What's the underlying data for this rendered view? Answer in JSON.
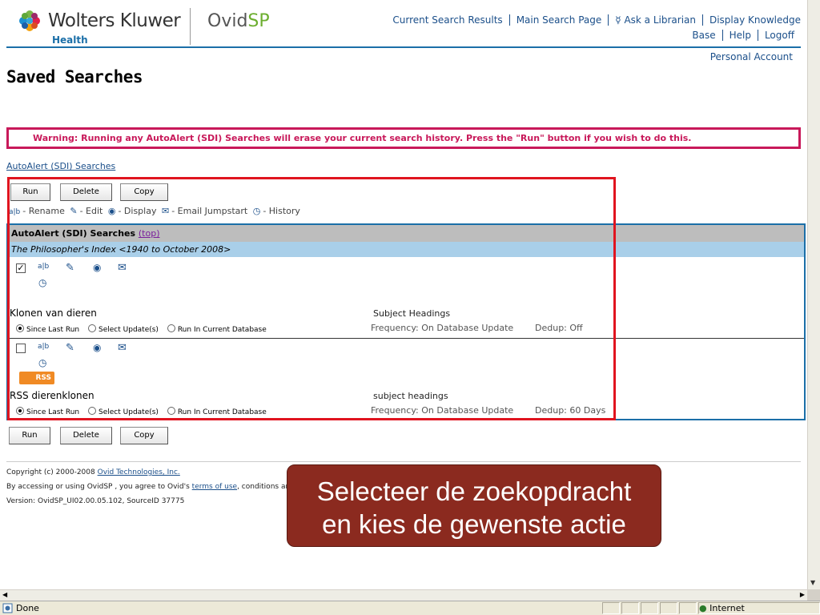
{
  "brand": {
    "company": "Wolters Kluwer",
    "division": "Health",
    "product_a": "Ovid",
    "product_b": "SP"
  },
  "nav": {
    "links": [
      "Current Search Results",
      "Main Search Page",
      "Ask a Librarian",
      "Display Knowledge"
    ],
    "links_row2": [
      "Base",
      "Help",
      "Logoff"
    ],
    "personal": "Personal Account"
  },
  "page_title": "Saved Searches",
  "warning": "Warning: Running any AutoAlert (SDI) Searches will erase your current search history. Press the \"Run\" button if you wish to do this.",
  "section_link": "AutoAlert (SDI) Searches",
  "buttons": {
    "run": "Run",
    "delete": "Delete",
    "copy": "Copy"
  },
  "legend": {
    "rename": "- Rename",
    "edit": "- Edit",
    "display": "- Display",
    "email": "- Email Jumpstart",
    "history": "- History"
  },
  "results": {
    "header": "AutoAlert (SDI) Searches",
    "top_link": "(top)",
    "database": "The Philosopher's Index <1940 to October 2008>",
    "radio_options": [
      "Since Last Run",
      "Select Update(s)",
      "Run In Current Database"
    ],
    "rows": [
      {
        "checked": true,
        "name": "Klonen van dieren",
        "subject": "Subject Headings",
        "frequency": "Frequency: On Database Update",
        "dedup": "Dedup: Off"
      },
      {
        "checked": false,
        "name": "RSS dierenklonen",
        "subject": "subject headings",
        "frequency": "Frequency: On Database Update",
        "dedup": "Dedup: 60 Days",
        "rss": "RSS"
      }
    ]
  },
  "footer": {
    "copyright": "Copyright (c) 2000-2008",
    "copyright_link": "Ovid Technologies, Inc.",
    "terms_pre": "By accessing or using OvidSP , you agree to Ovid's",
    "terms_link": "terms of use",
    "terms_post": ", conditions and",
    "version": "Version: OvidSP_UI02.00.05.102, SourceID 37775"
  },
  "callout": {
    "line1": "Selecteer de zoekopdracht",
    "line2": "en kies de gewenste actie"
  },
  "status": {
    "text": "Done",
    "zone": "Internet"
  }
}
